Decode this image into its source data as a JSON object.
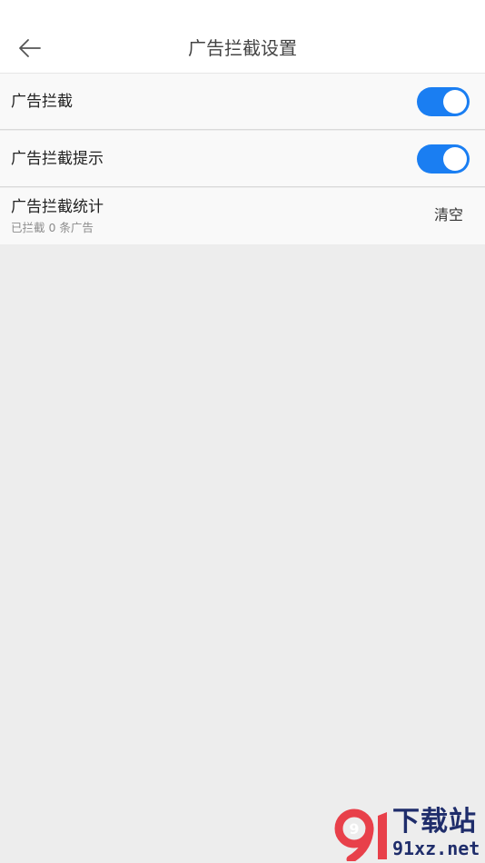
{
  "header": {
    "title": "广告拦截设置",
    "back_icon": "arrow-left-icon"
  },
  "settings": {
    "ad_block": {
      "label": "广告拦截",
      "enabled": true
    },
    "ad_block_tip": {
      "label": "广告拦截提示",
      "enabled": true
    },
    "ad_block_stats": {
      "label": "广告拦截统计",
      "sublabel": "已拦截 0 条广告",
      "clear_label": "清空"
    }
  },
  "watermark": {
    "logo_text": "9",
    "line1": "下载站",
    "line2": "91xz.net"
  },
  "colors": {
    "accent": "#1a7ef2",
    "brand_red": "#e8404a",
    "brand_navy": "#1f2d6b",
    "background": "#ededed"
  }
}
